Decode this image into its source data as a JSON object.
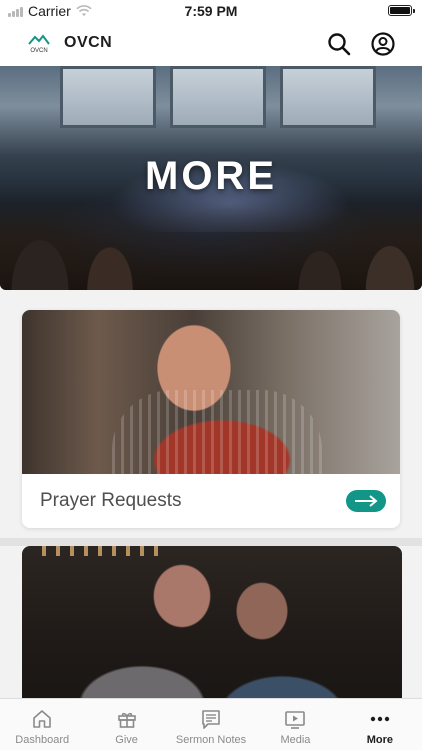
{
  "status_bar": {
    "carrier": "Carrier",
    "time": "7:59 PM"
  },
  "header": {
    "logo_text": "OVCN",
    "title": "OVCN",
    "search_icon": "search-icon",
    "account_icon": "account-circle-icon"
  },
  "hero": {
    "title": "MORE"
  },
  "cards": [
    {
      "title": "Prayer Requests",
      "arrow_icon": "arrow-right-icon"
    }
  ],
  "tab_bar": {
    "items": [
      {
        "label": "Dashboard",
        "icon": "home-icon",
        "active": false
      },
      {
        "label": "Give",
        "icon": "gift-icon",
        "active": false
      },
      {
        "label": "Sermon Notes",
        "icon": "note-icon",
        "active": false
      },
      {
        "label": "Media",
        "icon": "play-screen-icon",
        "active": false
      },
      {
        "label": "More",
        "icon": "more-dots-icon",
        "active": true
      }
    ]
  },
  "colors": {
    "accent": "#129688",
    "tab_inactive": "#8a8a8a",
    "tab_active": "#1d1d1f"
  }
}
